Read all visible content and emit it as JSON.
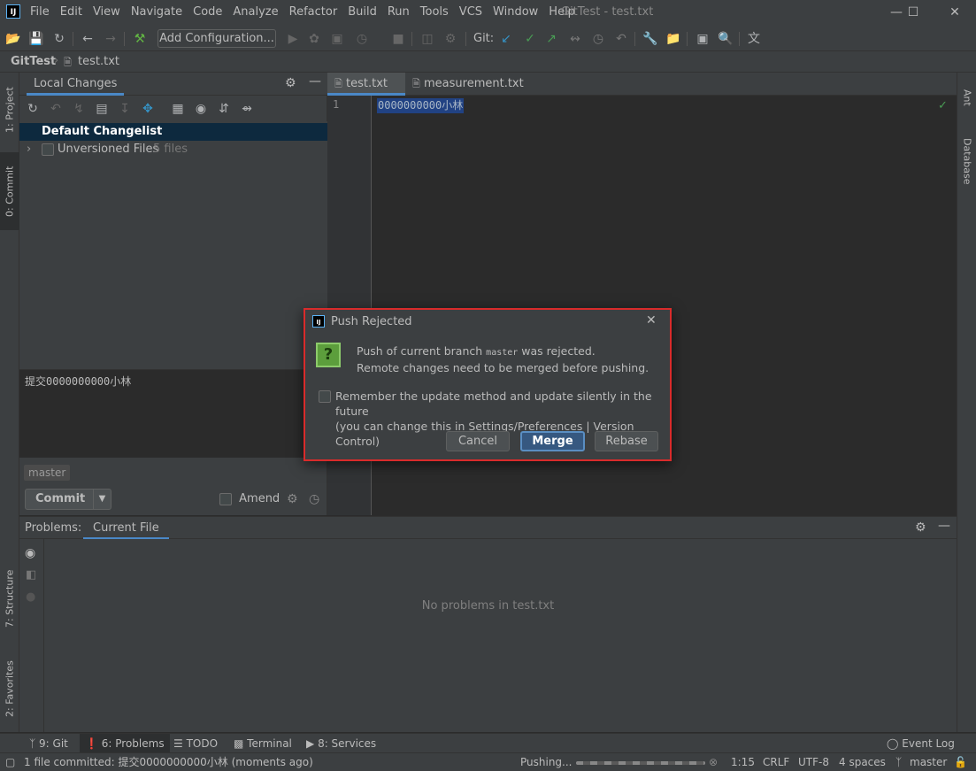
{
  "menubar": {
    "items": [
      "File",
      "Edit",
      "View",
      "Navigate",
      "Code",
      "Analyze",
      "Refactor",
      "Build",
      "Run",
      "Tools",
      "VCS",
      "Window",
      "Help"
    ],
    "window_title": "GitTest - test.txt",
    "minimize": "—",
    "maximize": "☐",
    "close": "✕"
  },
  "toolbar": {
    "add_configuration": "Add Configuration...",
    "git_label": "Git:"
  },
  "breadcrumb": {
    "project": "GitTest",
    "file": "test.txt"
  },
  "left_stripe": {
    "project": "1: Project",
    "commit": "0: Commit",
    "structure": "7: Structure",
    "favorites": "2: Favorites"
  },
  "right_stripe": {
    "ant": "Ant",
    "database": "Database"
  },
  "commit_panel": {
    "tab_label": "Local Changes",
    "default_changelist": "Default Changelist",
    "unversioned_label": "Unversioned Files",
    "unversioned_count": "5 files",
    "commit_message": "提交0000000000小林",
    "branch": "master",
    "commit_button": "Commit",
    "amend_label": "Amend"
  },
  "editor": {
    "tabs": [
      {
        "label": "test.txt",
        "active": true
      },
      {
        "label": "measurement.txt",
        "active": false
      }
    ],
    "line_number": "1",
    "line_text": "0000000000小林"
  },
  "problems": {
    "label": "Problems:",
    "tab": "Current File",
    "empty_text": "No problems in test.txt"
  },
  "bottom_tabs": {
    "git": "9: Git",
    "problems": "6: Problems",
    "todo": "TODO",
    "terminal": "Terminal",
    "services": "8: Services",
    "event_log": "Event Log"
  },
  "status": {
    "message": "1 file committed: 提交0000000000小林 (moments ago)",
    "pushing": "Pushing...",
    "position": "1:15",
    "line_sep": "CRLF",
    "encoding": "UTF-8",
    "indent": "4 spaces",
    "branch": "master"
  },
  "dialog": {
    "title": "Push Rejected",
    "line1_prefix": "Push of current branch ",
    "branch": "master",
    "line1_suffix": " was rejected.",
    "line2": "Remote changes need to be merged before pushing.",
    "remember_label": "Remember the update method and update silently in the future",
    "remember_hint": "(you can change this in Settings/Preferences | Version Control)",
    "cancel": "Cancel",
    "merge": "Merge",
    "rebase": "Rebase"
  },
  "colors": {
    "accent": "#4a88c7",
    "selection": "#0d293e",
    "dialog_border": "#d92b2b",
    "ok_green": "#499c54"
  }
}
